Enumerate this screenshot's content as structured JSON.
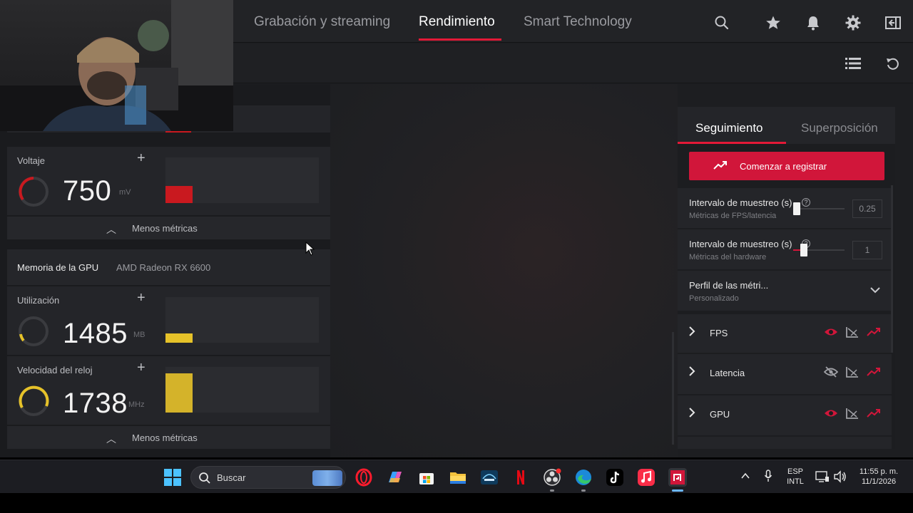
{
  "nav": {
    "tabs": [
      {
        "label": "Grabación y streaming",
        "active": false
      },
      {
        "label": "Rendimiento",
        "active": true
      },
      {
        "label": "Smart Technology",
        "active": false
      }
    ],
    "icons": [
      "search-icon",
      "star-icon",
      "bell-icon",
      "gear-icon",
      "panel-toggle-icon"
    ],
    "accent": "#e31937"
  },
  "subbar": {
    "icons": [
      "list-view-icon",
      "reset-icon"
    ]
  },
  "left": {
    "voltage": {
      "label": "Voltaje",
      "value": "750",
      "unit": "mV",
      "color": "#c9191f"
    },
    "less_metrics_1": "Menos métricas",
    "gpu_memory": {
      "title": "Memoria de la GPU",
      "device": "AMD Radeon RX 6600"
    },
    "utilization": {
      "label": "Utilización",
      "value": "1485",
      "unit": "MB",
      "color": "#e6c229"
    },
    "clock": {
      "label": "Velocidad del reloj",
      "value": "1738",
      "unit": "MHz",
      "color": "#e6c229"
    },
    "less_metrics_2": "Menos métricas"
  },
  "right": {
    "tabs": [
      {
        "label": "Seguimiento",
        "active": true
      },
      {
        "label": "Superposición",
        "active": false
      }
    ],
    "record_button": "Comenzar a registrar",
    "sampling_1": {
      "label": "Intervalo de muestreo (s)",
      "sublabel": "Métricas de FPS/latencia",
      "value": "0.25",
      "help": "?"
    },
    "sampling_2": {
      "label": "Intervalo de muestreo (s)",
      "sublabel": "Métricas del hardware",
      "value": "1",
      "help": "?"
    },
    "profile": {
      "label": "Perfil de las métri...",
      "sublabel": "Personalizado"
    },
    "metric_groups": [
      {
        "name": "FPS",
        "visible": true
      },
      {
        "name": "Latencia",
        "visible": false
      },
      {
        "name": "GPU",
        "visible": true
      }
    ]
  },
  "taskbar": {
    "search_label": "Buscar",
    "language": "ESP",
    "layout": "INTL",
    "time": "11:55 p. m.",
    "date": "11/1/2026"
  }
}
